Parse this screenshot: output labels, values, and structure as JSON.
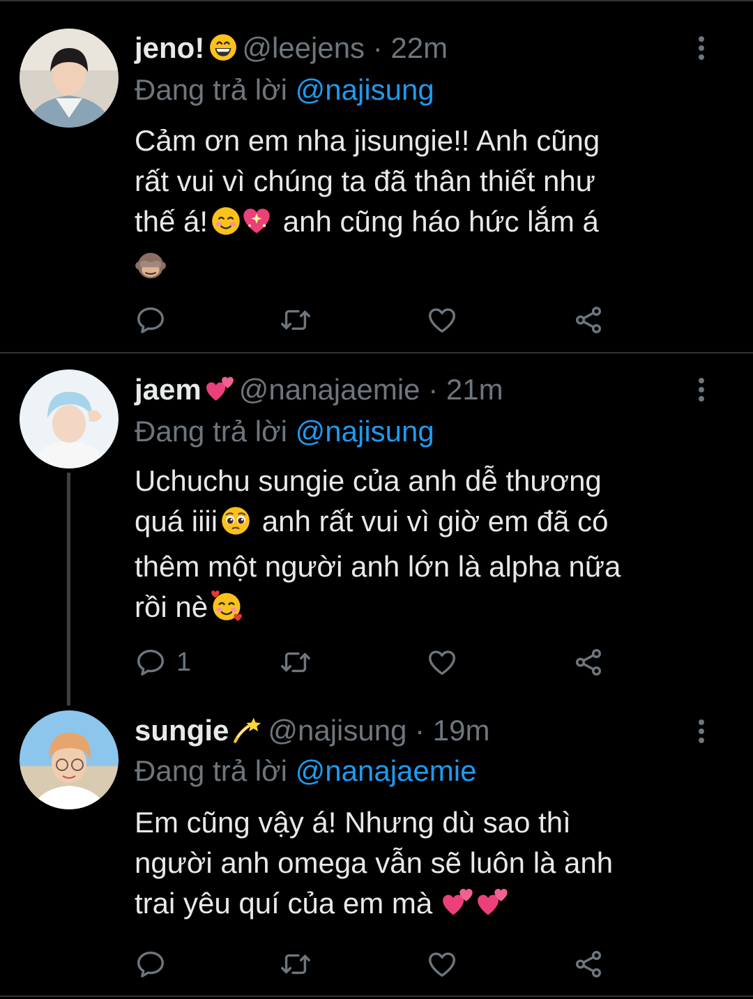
{
  "tweets": [
    {
      "name": "jeno!",
      "name_emoji": "grinning-face-emoji",
      "handle": "@leejens",
      "separator": "·",
      "time": "22m",
      "reply_prefix": "Đang trả lời",
      "reply_to": "@najisung",
      "body": {
        "line1": "Cảm ơn em nha jisungie!! Anh cũng",
        "line2": "rất vui vì chúng ta đã thân thiết như",
        "line3a": "thế á!",
        "line3_emojis": [
          "smiling-face-emoji",
          "sparkling-heart-emoji"
        ],
        "line3b": "anh cũng háo hức lắm á",
        "line4_emoji": "see-no-evil-monkey-emoji"
      },
      "actions": {
        "reply_count": "",
        "retweet_count": "",
        "like_count": ""
      }
    },
    {
      "name": "jaem",
      "name_emoji": "two-hearts-emoji",
      "handle": "@nanajaemie",
      "separator": "·",
      "time": "21m",
      "reply_prefix": "Đang trả lời",
      "reply_to": "@najisung",
      "body": {
        "line1": "Uchuchu sungie của anh dễ thương",
        "line2a": "quá iiii",
        "line2_emoji": "pleading-face-emoji",
        "line2b": "anh rất vui vì giờ em đã có",
        "line3": "thêm một người anh lớn là alpha nữa",
        "line4": "rồi nè",
        "line4_emoji": "smiling-face-with-hearts-emoji"
      },
      "actions": {
        "reply_count": "1",
        "retweet_count": "",
        "like_count": ""
      }
    },
    {
      "name": "sungie",
      "name_emoji": "dizzy-emoji",
      "handle": "@najisung",
      "separator": "·",
      "time": "19m",
      "reply_prefix": "Đang trả lời",
      "reply_to": "@nanajaemie",
      "body": {
        "line1": "Em cũng vậy á! Nhưng dù sao thì",
        "line2": "người anh omega vẫn sẽ luôn là anh",
        "line3": "trai yêu quí của em mà",
        "line3_emojis": [
          "two-hearts-emoji",
          "two-hearts-emoji"
        ]
      },
      "actions": {
        "reply_count": "",
        "retweet_count": "",
        "like_count": ""
      }
    }
  ],
  "colors": {
    "background": "#000000",
    "text_primary": "#e7e9ea",
    "text_secondary": "#6e767d",
    "mention": "#1d9bf0",
    "divider": "#2f3336"
  }
}
